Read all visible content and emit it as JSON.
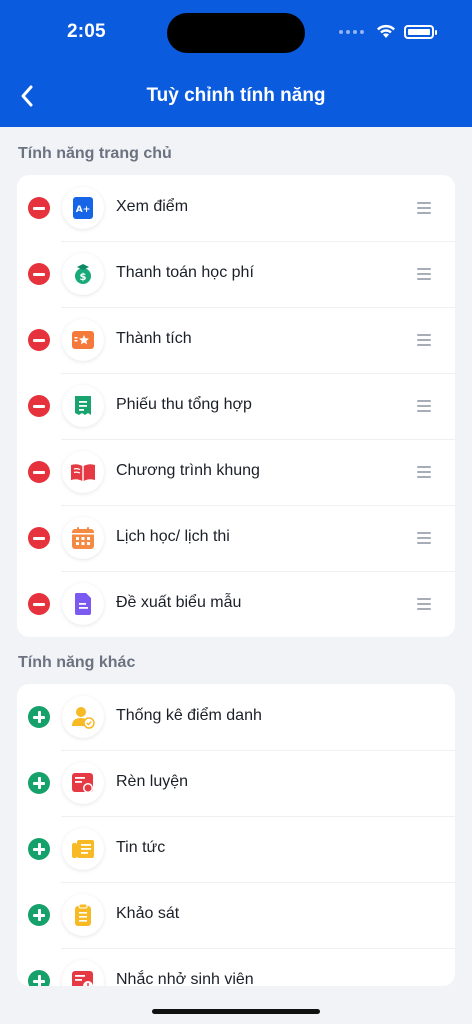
{
  "status_bar": {
    "time": "2:05"
  },
  "header": {
    "title": "Tuỳ chỉnh tính năng"
  },
  "colors": {
    "brand": "#0a5bde",
    "remove": "#e5323d",
    "add": "#16a06a"
  },
  "home_section": {
    "title": "Tính năng trang chủ",
    "items": [
      {
        "label": "Xem điểm",
        "icon": "grade-a-plus-icon"
      },
      {
        "label": "Thanh toán học phí",
        "icon": "tuition-money-icon"
      },
      {
        "label": "Thành tích",
        "icon": "achievement-star-icon"
      },
      {
        "label": "Phiếu thu tổng hợp",
        "icon": "receipt-icon"
      },
      {
        "label": "Chương trình khung",
        "icon": "open-book-icon"
      },
      {
        "label": "Lịch học/ lịch thi",
        "icon": "calendar-icon"
      },
      {
        "label": "Đề xuất biểu mẫu",
        "icon": "form-document-icon"
      }
    ]
  },
  "other_section": {
    "title": "Tính năng khác",
    "items": [
      {
        "label": "Thống kê điểm danh",
        "icon": "attendance-user-check-icon"
      },
      {
        "label": "Rèn luyện",
        "icon": "training-record-icon"
      },
      {
        "label": "Tin tức",
        "icon": "news-icon"
      },
      {
        "label": "Khảo sát",
        "icon": "survey-clipboard-icon"
      },
      {
        "label": "Nhắc nhở sinh viên",
        "icon": "reminder-icon"
      }
    ]
  }
}
